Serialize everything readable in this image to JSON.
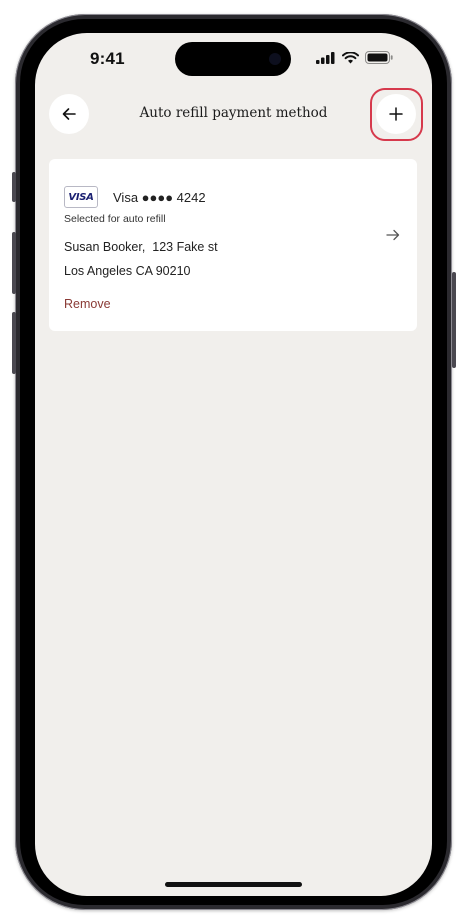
{
  "status_bar": {
    "time": "9:41"
  },
  "header": {
    "title": "Auto refill payment method",
    "back_icon": "arrow-left-icon",
    "add_icon": "plus-icon"
  },
  "payment_card": {
    "brand_logo": "VISA",
    "label": "Visa ●●●● 4242",
    "status": "Selected for auto refill",
    "address_line_1": "Susan Booker,  123 Fake st",
    "address_line_2": "Los Angeles CA 90210",
    "remove_label": "Remove",
    "chevron_icon": "arrow-right-icon"
  },
  "colors": {
    "background": "#f1efec",
    "card": "#ffffff",
    "remove_link": "#8a3a35",
    "highlight": "#d6394c",
    "visa_blue": "#1a1f71"
  }
}
